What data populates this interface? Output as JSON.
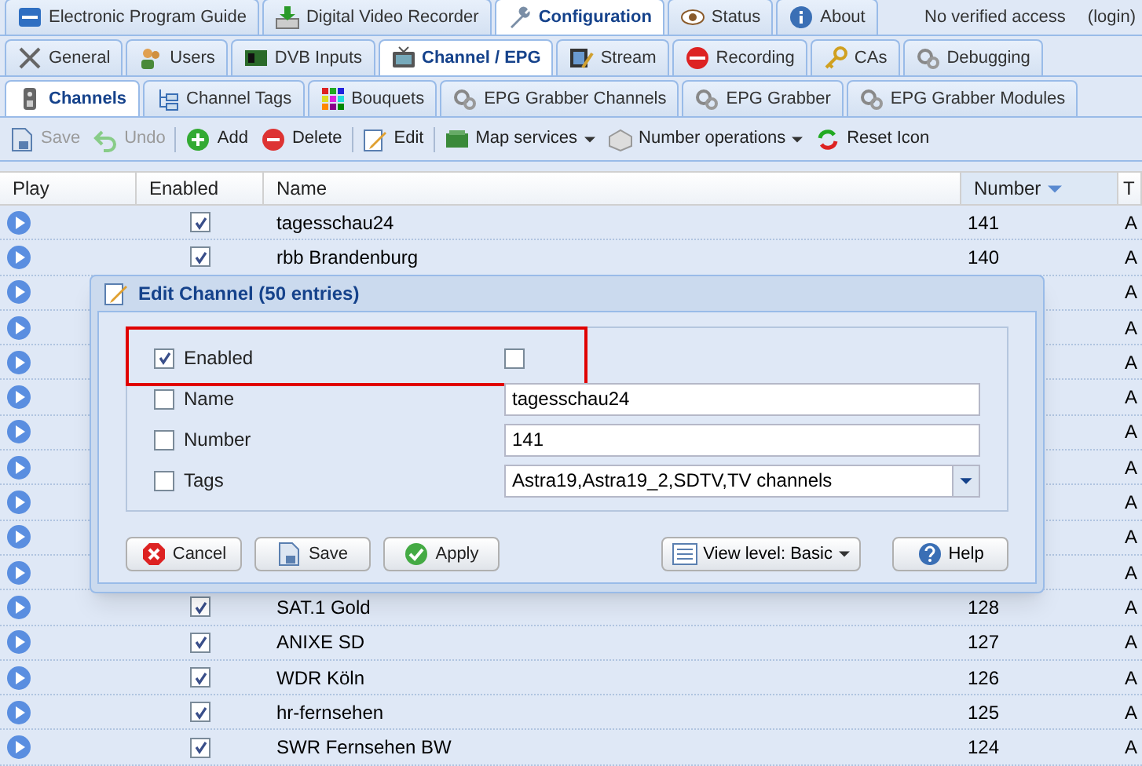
{
  "main_tabs": [
    {
      "label": "Electronic Program Guide",
      "selected": false
    },
    {
      "label": "Digital Video Recorder",
      "selected": false
    },
    {
      "label": "Configuration",
      "selected": true
    },
    {
      "label": "Status",
      "selected": false
    },
    {
      "label": "About",
      "selected": false
    }
  ],
  "access": "No verified access",
  "login": "(login)",
  "config_tabs": [
    {
      "label": "General",
      "selected": false
    },
    {
      "label": "Users",
      "selected": false
    },
    {
      "label": "DVB Inputs",
      "selected": false
    },
    {
      "label": "Channel / EPG",
      "selected": true
    },
    {
      "label": "Stream",
      "selected": false
    },
    {
      "label": "Recording",
      "selected": false
    },
    {
      "label": "CAs",
      "selected": false
    },
    {
      "label": "Debugging",
      "selected": false
    }
  ],
  "sub_tabs": [
    {
      "label": "Channels",
      "selected": true
    },
    {
      "label": "Channel Tags",
      "selected": false
    },
    {
      "label": "Bouquets",
      "selected": false
    },
    {
      "label": "EPG Grabber Channels",
      "selected": false
    },
    {
      "label": "EPG Grabber",
      "selected": false
    },
    {
      "label": "EPG Grabber Modules",
      "selected": false
    }
  ],
  "toolbar": [
    {
      "kind": "button",
      "label": "Save",
      "disabled": true
    },
    {
      "kind": "button",
      "label": "Undo",
      "disabled": true
    },
    {
      "kind": "separator"
    },
    {
      "kind": "button",
      "label": "Add",
      "disabled": false
    },
    {
      "kind": "button",
      "label": "Delete",
      "disabled": false
    },
    {
      "kind": "separator"
    },
    {
      "kind": "button",
      "label": "Edit",
      "disabled": false
    },
    {
      "kind": "separator"
    },
    {
      "kind": "menu",
      "label": "Map services",
      "disabled": false
    },
    {
      "kind": "menu",
      "label": "Number operations",
      "disabled": false
    },
    {
      "kind": "button",
      "label": "Reset Icon",
      "disabled": false
    }
  ],
  "table": {
    "columns": [
      {
        "label": "Play",
        "sorted": false
      },
      {
        "label": "Enabled",
        "sorted": false
      },
      {
        "label": "Name",
        "sorted": false
      },
      {
        "label": "Number",
        "sorted": true
      },
      {
        "label": "T",
        "sorted": false
      }
    ],
    "rows": [
      {
        "selected": true,
        "enabled": true,
        "name": "tagesschau24",
        "number": "141",
        "tags": "A"
      },
      {
        "selected": true,
        "enabled": true,
        "name": "rbb Brandenburg",
        "number": "140",
        "tags": "A"
      },
      {
        "selected": true,
        "tags": "A"
      },
      {
        "selected": true,
        "tags": "A"
      },
      {
        "selected": true,
        "tags": "A"
      },
      {
        "selected": true,
        "tags": "A"
      },
      {
        "selected": true,
        "tags": "A"
      },
      {
        "selected": true,
        "tags": "A"
      },
      {
        "selected": true,
        "tags": "A"
      },
      {
        "selected": true,
        "tags": "A"
      },
      {
        "selected": true,
        "tags": "A"
      },
      {
        "selected": true,
        "enabled": true,
        "name": "SAT.1 Gold",
        "number": "128",
        "tags": "A"
      },
      {
        "selected": true,
        "enabled": true,
        "name": "ANIXE SD",
        "number": "127",
        "tags": "A"
      },
      {
        "selected": true,
        "enabled": true,
        "name": "WDR Köln",
        "number": "126",
        "tags": "A"
      },
      {
        "selected": true,
        "enabled": true,
        "name": "hr-fernsehen",
        "number": "125",
        "tags": "A"
      },
      {
        "selected": true,
        "enabled": true,
        "name": "SWR Fernsehen BW",
        "number": "124",
        "tags": "A"
      }
    ]
  },
  "dialog": {
    "title": "Edit Channel (50 entries)",
    "fields": [
      {
        "kind": "checkbox",
        "label": "Enabled",
        "apply": true,
        "checked": false,
        "highlighted": true
      },
      {
        "kind": "text",
        "label": "Name",
        "apply": false,
        "value": "tagesschau24",
        "highlighted": false
      },
      {
        "kind": "text",
        "label": "Number",
        "apply": false,
        "value": "141",
        "highlighted": false
      },
      {
        "kind": "combo",
        "label": "Tags",
        "apply": false,
        "value": "Astra19,Astra19_2,SDTV,TV channels",
        "highlighted": false
      }
    ],
    "buttons": [
      "Cancel",
      "Save",
      "Apply"
    ],
    "view_level": "View level: Basic",
    "help": "Help"
  }
}
